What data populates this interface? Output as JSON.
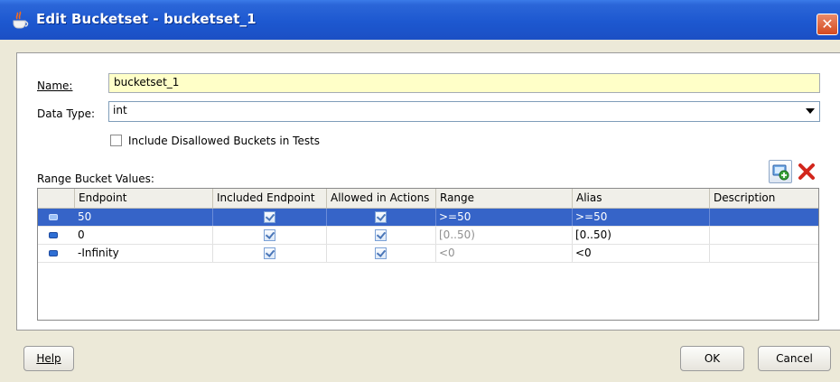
{
  "window": {
    "title": "Edit Bucketset - bucketset_1"
  },
  "form": {
    "name_label": "Name:",
    "name_value": "bucketset_1",
    "datatype_label": "Data Type:",
    "datatype_value": "int",
    "include_disallowed_label": "Include Disallowed Buckets in Tests",
    "include_disallowed_checked": false,
    "range_bucket_label": "Range Bucket Values:"
  },
  "table": {
    "columns": [
      "Endpoint",
      "Included Endpoint",
      "Allowed in Actions",
      "Range",
      "Alias",
      "Description"
    ],
    "rows": [
      {
        "endpoint": "50",
        "included": true,
        "allowed": true,
        "range": ">=50",
        "alias": ">=50",
        "description": "",
        "selected": true
      },
      {
        "endpoint": "0",
        "included": true,
        "allowed": true,
        "range": "[0..50)",
        "alias": "[0..50)",
        "description": "",
        "selected": false
      },
      {
        "endpoint": "-Infinity",
        "included": true,
        "allowed": true,
        "range": "<0",
        "alias": "<0",
        "description": "",
        "selected": false
      }
    ]
  },
  "buttons": {
    "help": "Help",
    "ok": "OK",
    "cancel": "Cancel"
  },
  "icons": {
    "title": "coffee-cup-icon",
    "close": "close-icon",
    "add": "add-bucket-icon",
    "delete": "delete-bucket-icon",
    "row": "bucket-row-icon"
  },
  "colors": {
    "titlebar": "#1d58d0",
    "selection": "#3664c8",
    "name_field": "#ffffc8"
  }
}
